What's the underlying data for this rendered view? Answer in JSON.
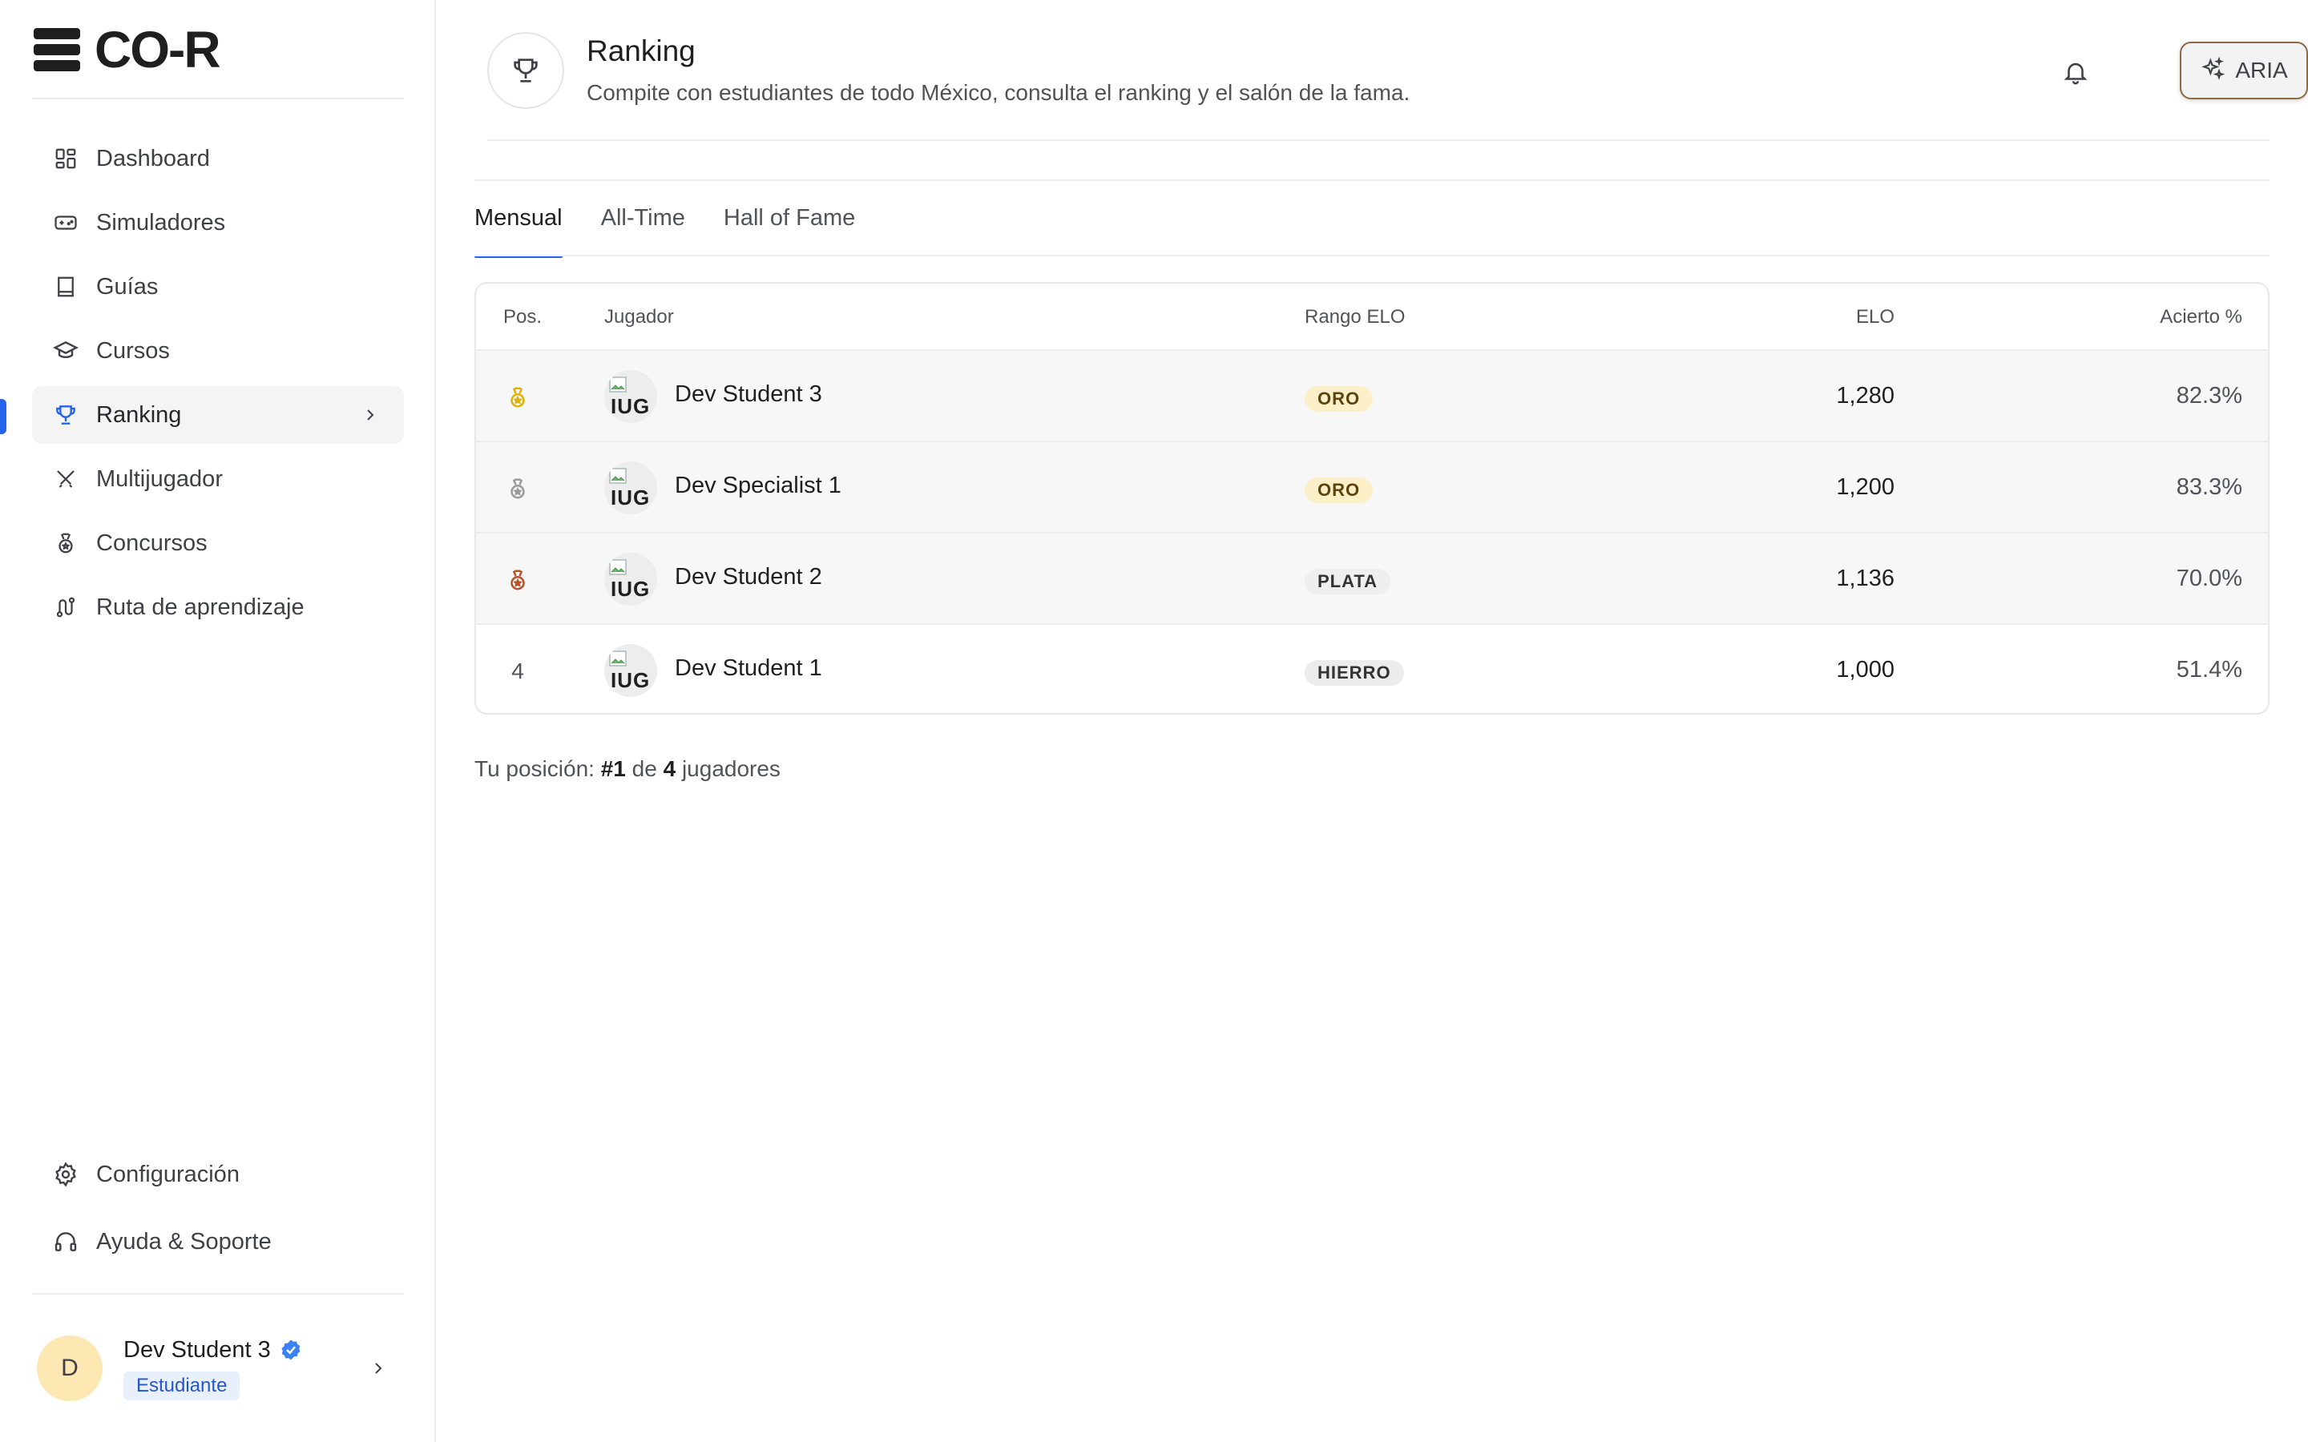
{
  "brand": {
    "name": "CO-R"
  },
  "sidebar": {
    "items": [
      {
        "label": "Dashboard",
        "icon": "dashboard-icon"
      },
      {
        "label": "Simuladores",
        "icon": "gamepad-icon"
      },
      {
        "label": "Guías",
        "icon": "book-icon"
      },
      {
        "label": "Cursos",
        "icon": "graduation-cap-icon"
      },
      {
        "label": "Ranking",
        "icon": "trophy-icon",
        "active": true
      },
      {
        "label": "Multijugador",
        "icon": "swords-icon"
      },
      {
        "label": "Concursos",
        "icon": "medal-icon"
      },
      {
        "label": "Ruta de aprendizaje",
        "icon": "route-icon"
      }
    ],
    "bottom_items": [
      {
        "label": "Configuración",
        "icon": "gear-icon"
      },
      {
        "label": "Ayuda & Soporte",
        "icon": "headphones-icon"
      }
    ],
    "user": {
      "initial": "D",
      "name": "Dev Student 3",
      "role": "Estudiante"
    }
  },
  "header": {
    "title": "Ranking",
    "subtitle": "Compite con estudiantes de todo México, consulta el ranking y el salón de la fama.",
    "aria_label": "ARIA"
  },
  "tabs": [
    {
      "label": "Mensual",
      "active": true
    },
    {
      "label": "All-Time",
      "active": false
    },
    {
      "label": "Hall of Fame",
      "active": false
    }
  ],
  "table": {
    "headers": {
      "pos": "Pos.",
      "player": "Jugador",
      "rank": "Rango ELO",
      "elo": "ELO",
      "accuracy": "Acierto %"
    },
    "avatar_alt": "IUG",
    "rows": [
      {
        "pos": "",
        "medal": "gold",
        "name": "Dev Student 3",
        "rank": "ORO",
        "rank_class": "oro",
        "elo": "1,280",
        "accuracy": "82.3%"
      },
      {
        "pos": "",
        "medal": "silver",
        "name": "Dev Specialist 1",
        "rank": "ORO",
        "rank_class": "oro",
        "elo": "1,200",
        "accuracy": "83.3%"
      },
      {
        "pos": "",
        "medal": "bronze",
        "name": "Dev Student 2",
        "rank": "PLATA",
        "rank_class": "plata",
        "elo": "1,136",
        "accuracy": "70.0%"
      },
      {
        "pos": "4",
        "medal": "",
        "name": "Dev Student 1",
        "rank": "HIERRO",
        "rank_class": "hierro",
        "elo": "1,000",
        "accuracy": "51.4%"
      }
    ]
  },
  "footer_position": {
    "prefix": "Tu posición:",
    "rank": "#1",
    "of": "de",
    "total": "4",
    "suffix": "jugadores"
  },
  "colors": {
    "accent": "#2563eb",
    "gold": "#e0b100",
    "silver": "#9a9a9a",
    "bronze": "#b5532a"
  }
}
